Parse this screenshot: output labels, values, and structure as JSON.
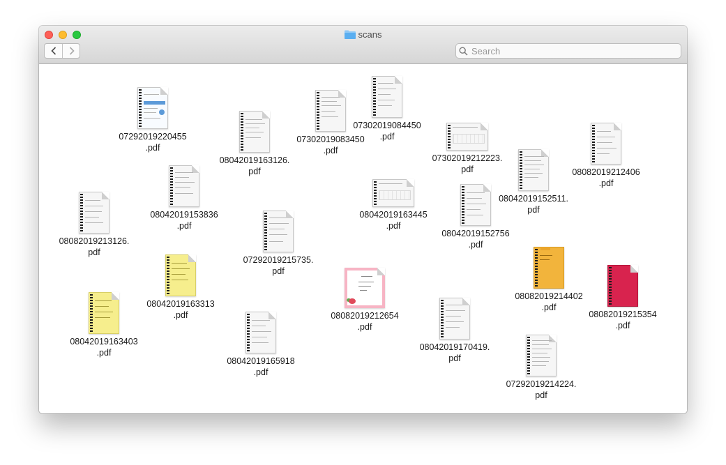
{
  "window": {
    "title": "scans",
    "folder_icon": "folder-icon",
    "folder_color": "#5aaef0"
  },
  "toolbar": {
    "back_icon": "chevron-left-icon",
    "forward_icon": "chevron-right-icon",
    "search_icon": "search-icon",
    "search_placeholder": "Search",
    "search_value": ""
  },
  "files": [
    {
      "line1": "07292019220455",
      "line2": ".pdf",
      "thumb": "blue-form",
      "orientation": "portrait"
    },
    {
      "line1": "08042019163126.",
      "line2": "pdf",
      "thumb": "gray-doc",
      "orientation": "portrait"
    },
    {
      "line1": "07302019083450",
      "line2": ".pdf",
      "thumb": "gray-doc",
      "orientation": "portrait"
    },
    {
      "line1": "07302019084450",
      "line2": ".pdf",
      "thumb": "gray-doc",
      "orientation": "portrait"
    },
    {
      "line1": "07302019212223.",
      "line2": "pdf",
      "thumb": "gray-grid",
      "orientation": "landscape"
    },
    {
      "line1": "08082019212406",
      "line2": ".pdf",
      "thumb": "gray-doc",
      "orientation": "portrait"
    },
    {
      "line1": "08042019153836",
      "line2": ".pdf",
      "thumb": "gray-doc",
      "orientation": "portrait"
    },
    {
      "line1": "08042019163445",
      "line2": ".pdf",
      "thumb": "gray-grid",
      "orientation": "landscape"
    },
    {
      "line1": "08042019152511.",
      "line2": "pdf",
      "thumb": "gray-doc",
      "orientation": "portrait"
    },
    {
      "line1": "08082019213126.",
      "line2": "pdf",
      "thumb": "gray-doc",
      "orientation": "portrait"
    },
    {
      "line1": "07292019215735.",
      "line2": "pdf",
      "thumb": "gray-doc",
      "orientation": "portrait"
    },
    {
      "line1": "08042019152756",
      "line2": ".pdf",
      "thumb": "gray-doc",
      "orientation": "portrait"
    },
    {
      "line1": "08042019163313",
      "line2": ".pdf",
      "thumb": "yellow-doc",
      "orientation": "portrait"
    },
    {
      "line1": "08082019214402",
      "line2": ".pdf",
      "thumb": "yellow-folder",
      "orientation": "portrait"
    },
    {
      "line1": "08082019212654",
      "line2": ".pdf",
      "thumb": "flower-card",
      "orientation": "portrait"
    },
    {
      "line1": "08082019215354",
      "line2": ".pdf",
      "thumb": "red-folder",
      "orientation": "portrait"
    },
    {
      "line1": "08042019163403",
      "line2": ".pdf",
      "thumb": "yellow-doc",
      "orientation": "portrait"
    },
    {
      "line1": "08042019170419.",
      "line2": "pdf",
      "thumb": "gray-doc",
      "orientation": "portrait"
    },
    {
      "line1": "08042019165918",
      "line2": ".pdf",
      "thumb": "gray-doc",
      "orientation": "portrait"
    },
    {
      "line1": "07292019214224.",
      "line2": "pdf",
      "thumb": "gray-doc",
      "orientation": "portrait"
    }
  ]
}
